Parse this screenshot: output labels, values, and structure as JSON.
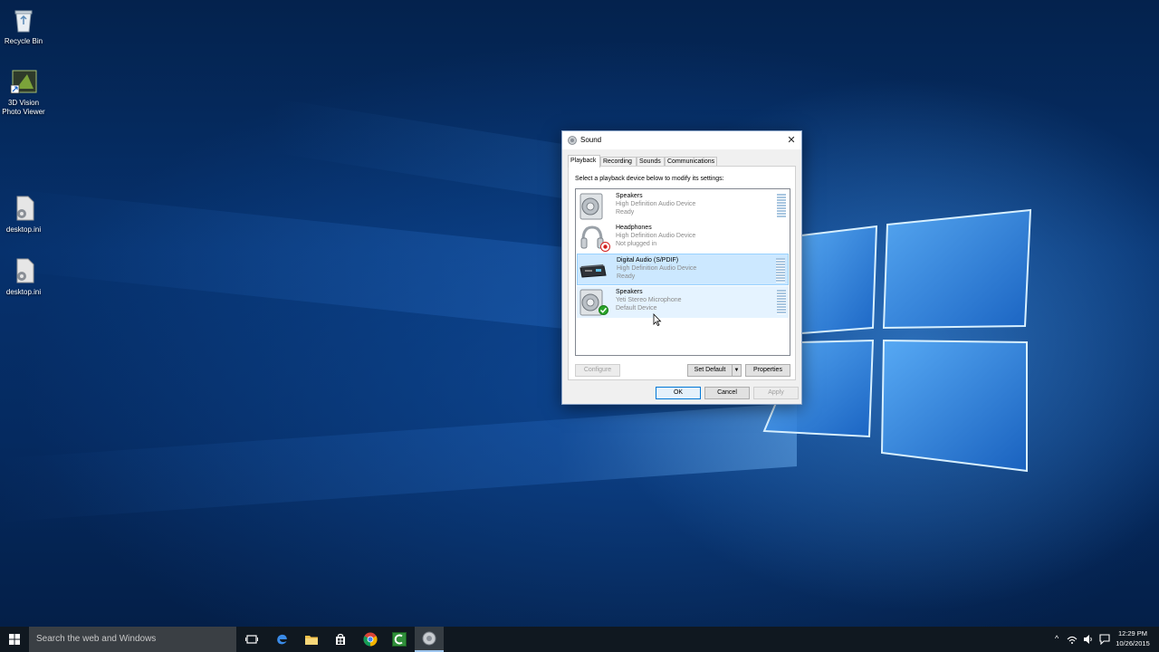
{
  "desktop": {
    "icons": [
      {
        "label": "Recycle Bin",
        "icon": "recycle-bin-icon"
      },
      {
        "label": "3D Vision Photo Viewer",
        "icon": "3d-vision-icon"
      },
      {
        "label": "desktop.ini",
        "icon": "settings-file-icon"
      },
      {
        "label": "desktop.ini",
        "icon": "settings-file-icon"
      }
    ]
  },
  "dialog": {
    "title": "Sound",
    "close_glyph": "✕",
    "tabs": [
      "Playback",
      "Recording",
      "Sounds",
      "Communications"
    ],
    "active_tab": "Playback",
    "instruction": "Select a playback device below to modify its settings:",
    "devices": [
      {
        "name": "Speakers",
        "description": "High Definition Audio Device",
        "status": "Ready",
        "icon": "speaker-icon",
        "state": "normal"
      },
      {
        "name": "Headphones",
        "description": "High Definition Audio Device",
        "status": "Not plugged in",
        "icon": "headphones-icon",
        "state": "normal",
        "badge": "not-plugged-in-badge"
      },
      {
        "name": "Digital Audio (S/PDIF)",
        "description": "High Definition Audio Device",
        "status": "Ready",
        "icon": "digital-audio-icon",
        "state": "selected"
      },
      {
        "name": "Speakers",
        "description": "Yeti Stereo Microphone",
        "status": "Default Device",
        "icon": "speaker-icon",
        "state": "hover",
        "badge": "default-device-check-badge"
      }
    ],
    "buttons": {
      "configure": "Configure",
      "set_default": "Set Default",
      "set_default_arrow": "▼",
      "properties": "Properties",
      "ok": "OK",
      "cancel": "Cancel",
      "apply": "Apply"
    },
    "colors": {
      "selected": "#cce8ff",
      "hover": "#e5f3ff",
      "default_check": "#2aa52a",
      "unplugged": "#d32020"
    }
  },
  "taskbar": {
    "search_placeholder": "Search the web and Windows",
    "pinned": [
      "task-view-icon",
      "edge-icon",
      "file-explorer-icon",
      "store-icon",
      "chrome-icon",
      "camtasia-icon",
      "sound-icon"
    ],
    "tray_chevron": "^",
    "time": "12:29 PM",
    "date": "10/26/2015"
  }
}
